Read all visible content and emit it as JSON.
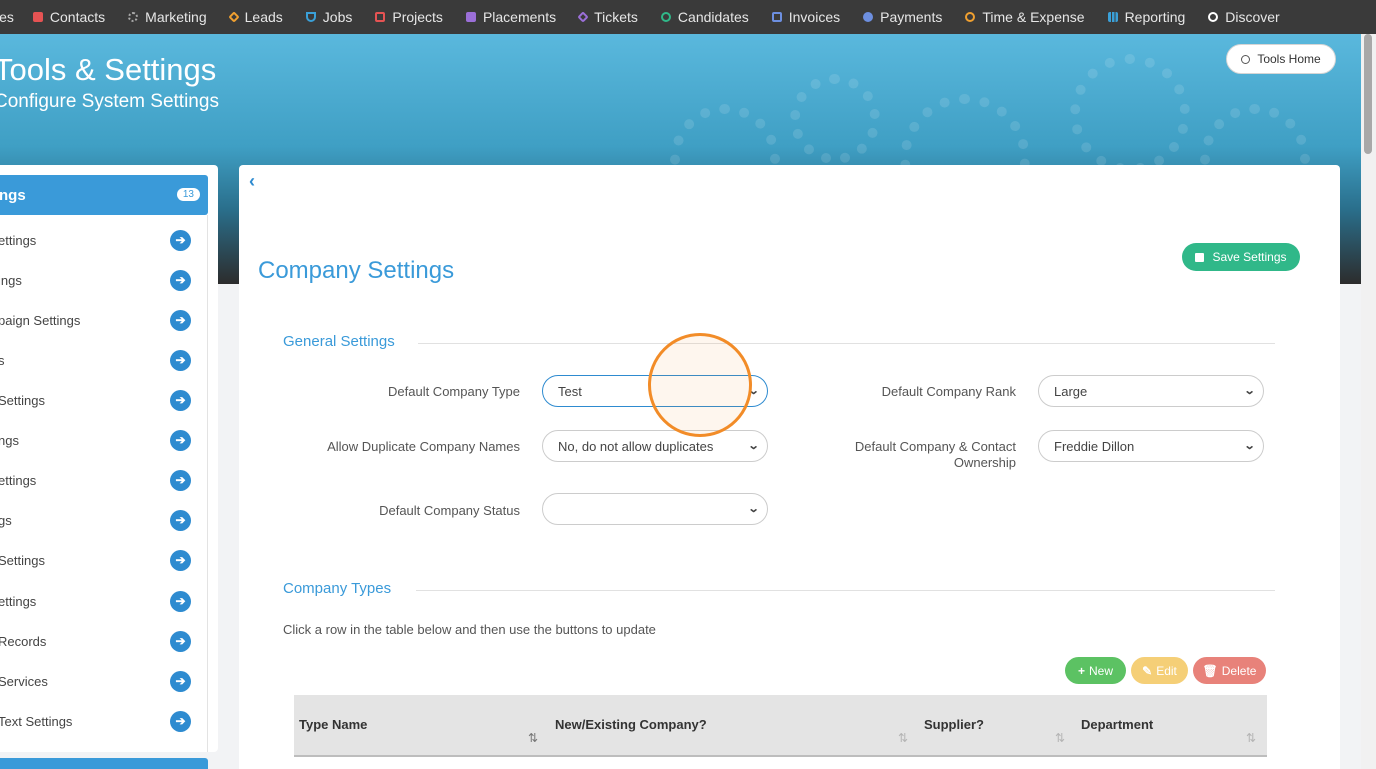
{
  "topnav": {
    "items": [
      {
        "label": "ies",
        "icon": "",
        "color": ""
      },
      {
        "label": "Contacts",
        "icon": "contacts-icon",
        "color": "#e55353"
      },
      {
        "label": "Marketing",
        "icon": "broadcast-icon",
        "color": "#aaaaaa"
      },
      {
        "label": "Leads",
        "icon": "leads-icon",
        "color": "#f0a030"
      },
      {
        "label": "Jobs",
        "icon": "jobs-icon",
        "color": "#3aa0d8"
      },
      {
        "label": "Projects",
        "icon": "projects-icon",
        "color": "#e55353"
      },
      {
        "label": "Placements",
        "icon": "placements-icon",
        "color": "#9b6fd8"
      },
      {
        "label": "Tickets",
        "icon": "tickets-icon",
        "color": "#9b6fd8"
      },
      {
        "label": "Candidates",
        "icon": "candidates-icon",
        "color": "#30b889"
      },
      {
        "label": "Invoices",
        "icon": "invoices-icon",
        "color": "#6d8fe0"
      },
      {
        "label": "Payments",
        "icon": "payments-icon",
        "color": "#6d8fe0"
      },
      {
        "label": "Time & Expense",
        "icon": "clock-icon",
        "color": "#f0a030"
      },
      {
        "label": "Reporting",
        "icon": "chart-icon",
        "color": "#3aa0d8"
      },
      {
        "label": "Discover",
        "icon": "search-icon",
        "color": "#ffffff"
      }
    ]
  },
  "hero": {
    "title": "Tools & Settings",
    "subtitle": "Configure System Settings",
    "tools_home_label": "Tools Home"
  },
  "sidebar": {
    "title": "ngs",
    "badge": "13",
    "items": [
      {
        "label": "ettings"
      },
      {
        "label": "ings"
      },
      {
        "label": "paign Settings"
      },
      {
        "label": "s"
      },
      {
        "label": "Settings"
      },
      {
        "label": "ngs"
      },
      {
        "label": "ettings"
      },
      {
        "label": "gs"
      },
      {
        "label": "Settings"
      },
      {
        "label": "ettings"
      },
      {
        "label": "Records"
      },
      {
        "label": "Services"
      },
      {
        "label": " Text Settings"
      }
    ]
  },
  "main": {
    "page_title": "Company Settings",
    "save_label": "Save Settings",
    "general": {
      "title": "General Settings",
      "fields": {
        "default_company_type": {
          "label": "Default Company Type",
          "value": "Test"
        },
        "default_company_rank": {
          "label": "Default Company Rank",
          "value": "Large"
        },
        "allow_duplicate": {
          "label": "Allow Duplicate Company Names",
          "value": "No, do not allow duplicates"
        },
        "ownership": {
          "label": "Default Company & Contact Ownership",
          "value": "Freddie Dillon"
        },
        "default_company_status": {
          "label": "Default Company Status",
          "value": ""
        }
      }
    },
    "types": {
      "title": "Company Types",
      "hint": "Click a row in the table below and then use the buttons to update",
      "new_label": "New",
      "edit_label": "Edit",
      "delete_label": "Delete",
      "columns": [
        "Type Name",
        "New/Existing Company?",
        "Supplier?",
        "Department"
      ]
    }
  },
  "colors": {
    "accent": "#3a9ad9",
    "save": "#30b889",
    "new": "#5cc263",
    "edit": "#f5cf77",
    "delete": "#e8827a",
    "click_marker": "#f28c28"
  }
}
